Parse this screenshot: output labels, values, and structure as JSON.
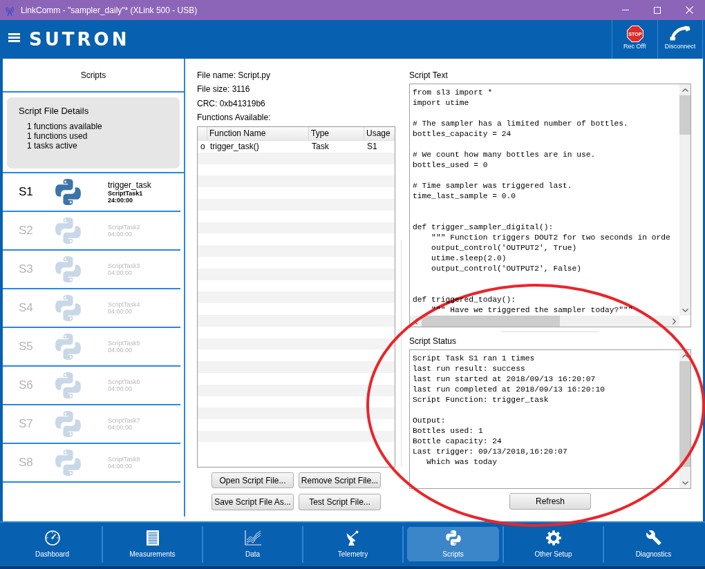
{
  "window": {
    "title": "LinkComm - \"sampler_daily\"* (XLink 500 - USB)"
  },
  "header": {
    "logo": "SUTRON",
    "actions": [
      {
        "kind": "record",
        "icon_text": "STOP",
        "label": "Rec Off!"
      },
      {
        "kind": "disconnect",
        "label": "Disconnect"
      }
    ]
  },
  "sidebar": {
    "title": "Scripts",
    "details": {
      "title": "Script File Details",
      "lines": [
        "1 functions available",
        "1 functions used",
        "1 tasks active"
      ]
    },
    "slots": [
      {
        "slot": "S1",
        "active": true,
        "function": "trigger_task",
        "task": "ScriptTask1",
        "interval": "24:00:00"
      },
      {
        "slot": "S2",
        "active": false,
        "task": "ScriptTask2",
        "interval": "04:00:00"
      },
      {
        "slot": "S3",
        "active": false,
        "task": "ScriptTask3",
        "interval": "04:00:00"
      },
      {
        "slot": "S4",
        "active": false,
        "task": "ScriptTask4",
        "interval": "04:00:00"
      },
      {
        "slot": "S5",
        "active": false,
        "task": "ScriptTask5",
        "interval": "04:00:00"
      },
      {
        "slot": "S6",
        "active": false,
        "task": "ScriptTask6",
        "interval": "04:00:00"
      },
      {
        "slot": "S7",
        "active": false,
        "task": "ScriptTask7",
        "interval": "04:00:00"
      },
      {
        "slot": "S8",
        "active": false,
        "task": "ScriptTask8",
        "interval": "04:00:00"
      }
    ]
  },
  "file_info": {
    "lines": [
      "File name: Script.py",
      "File size: 3116",
      "CRC: 0xb41319b6"
    ],
    "functions_label": "Functions Available:"
  },
  "functions_table": {
    "columns": [
      "Function Name",
      "Type",
      "Usage"
    ],
    "rows": [
      {
        "marker": "o",
        "cells": [
          "trigger_task()",
          "Task",
          "S1"
        ]
      }
    ]
  },
  "file_buttons": [
    "Open Script File...",
    "Remove Script File...",
    "Save Script File As...",
    "Test Script File..."
  ],
  "script_text": {
    "label": "Script Text",
    "code": "from sl3 import *\nimport utime\n\n# The sampler has a limited number of bottles.\nbottles_capacity = 24\n\n# We count how many bottles are in use.\nbottles_used = 0\n\n# Time sampler was triggered last.\ntime_last_sample = 0.0\n\n\ndef trigger_sampler_digital():\n    \"\"\" Function triggers DOUT2 for two seconds in orde\n    output_control('OUTPUT2', True)\n    utime.sleep(2.0)\n    output_control('OUTPUT2', False)\n\n\ndef triggered_today():\n    \"\"\" Have we triggered the sampler today?\"\"\""
  },
  "script_status": {
    "label": "Script Status",
    "text": "Script Task S1 ran 1 times\nlast run result: success\nlast run started at 2018/09/13 16:20:07\nlast run completed at 2018/09/13 16:20:10\nScript Function: trigger_task\n\nOutput:\nBottles used: 1\nBottle capacity: 24\nLast trigger: 09/13/2018,16:20:07\n   Which was today",
    "button": "Refresh"
  },
  "nav": [
    {
      "label": "Dashboard",
      "selected": false
    },
    {
      "label": "Measurements",
      "selected": false
    },
    {
      "label": "Data",
      "selected": false
    },
    {
      "label": "Telemetry",
      "selected": false
    },
    {
      "label": "Scripts",
      "selected": true
    },
    {
      "label": "Other Setup",
      "selected": false
    },
    {
      "label": "Diagnostics",
      "selected": false
    }
  ],
  "annotation": {
    "kind": "ellipse"
  }
}
